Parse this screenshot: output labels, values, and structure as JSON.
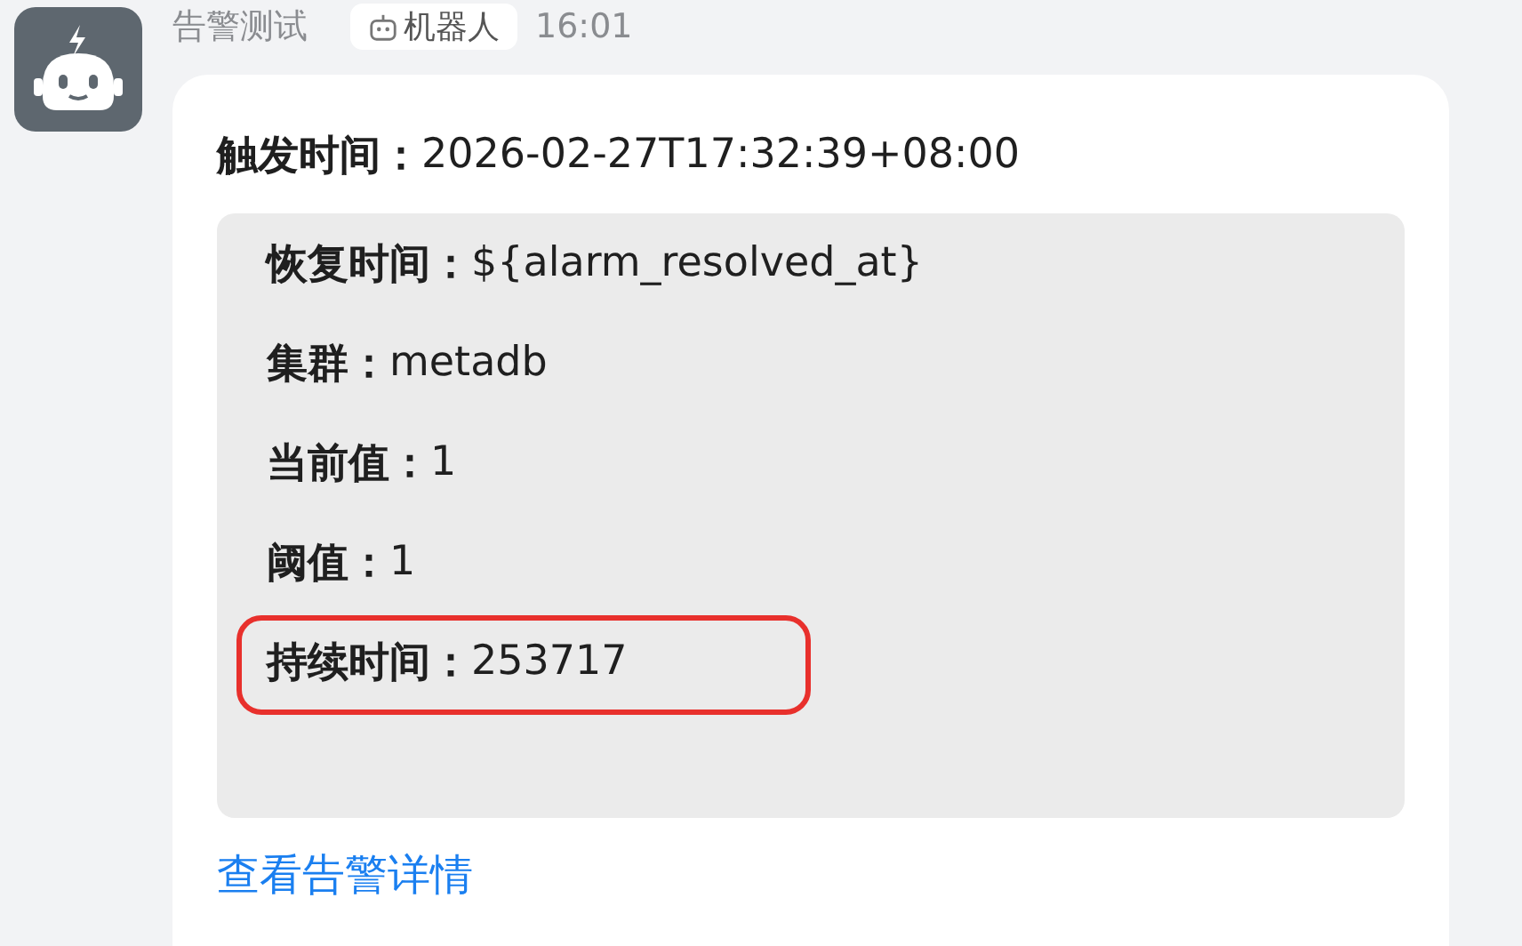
{
  "sender": {
    "name": "告警测试",
    "badge": "机器人",
    "time": "16:01"
  },
  "message": {
    "header": {
      "label": "触发时间：",
      "value": "2026-02-27T17:32:39+08:00"
    },
    "fields": [
      {
        "label": "恢复时间：",
        "value": "${alarm_resolved_at}",
        "highlighted": false
      },
      {
        "label": "集群：",
        "value": "metadb",
        "highlighted": false
      },
      {
        "label": "当前值：",
        "value": "1",
        "highlighted": false
      },
      {
        "label": "阈值：",
        "value": "1",
        "highlighted": false
      },
      {
        "label": "持续时间：",
        "value": "253717",
        "highlighted": true
      }
    ],
    "link": "查看告警详情"
  }
}
